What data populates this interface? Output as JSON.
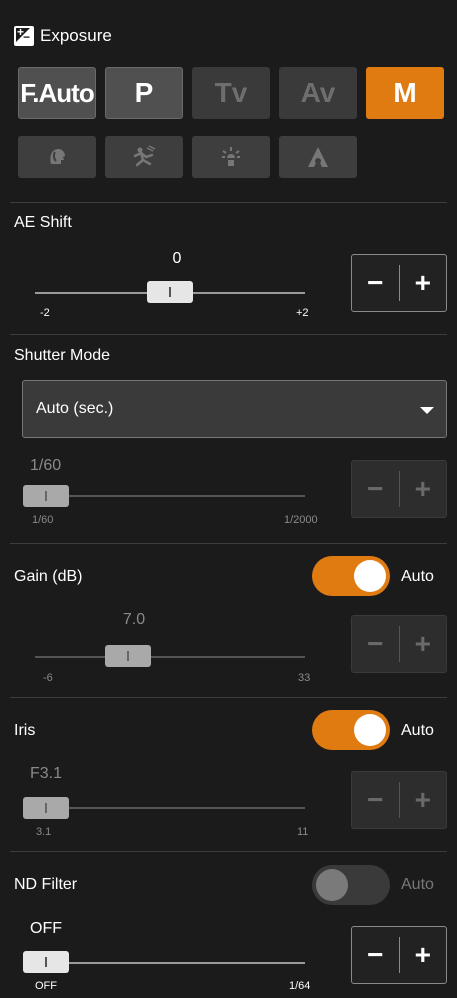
{
  "header": {
    "title": "Exposure",
    "icon": "exposure-icon"
  },
  "modes": [
    {
      "label": "F.Auto",
      "state": "enabled"
    },
    {
      "label": "P",
      "state": "enabled"
    },
    {
      "label": "Tv",
      "state": "disabled"
    },
    {
      "label": "Av",
      "state": "disabled"
    },
    {
      "label": "M",
      "state": "selected"
    }
  ],
  "scene_modes": [
    {
      "icon": "portrait-icon"
    },
    {
      "icon": "sports-icon"
    },
    {
      "icon": "spotlight-icon"
    },
    {
      "icon": "low-light-icon"
    }
  ],
  "ae_shift": {
    "label": "AE Shift",
    "value": "0",
    "min_label": "-2",
    "max_label": "+2",
    "level": 0.5,
    "minus": "−",
    "plus": "+"
  },
  "shutter_mode": {
    "label": "Shutter Mode",
    "selected": "Auto (sec.)",
    "value": "1/60",
    "min_label": "1/60",
    "max_label": "1/2000",
    "level": 0.0,
    "minus": "−",
    "plus": "+"
  },
  "gain": {
    "label": "Gain (dB)",
    "toggle_label": "Auto",
    "toggle_on": true,
    "value": "7.0",
    "min_label": "-6",
    "max_label": "33",
    "level": 0.33,
    "minus": "−",
    "plus": "+"
  },
  "iris": {
    "label": "Iris",
    "toggle_label": "Auto",
    "toggle_on": true,
    "value": "F3.1",
    "min_label": "3.1",
    "max_label": "11",
    "level": 0.0,
    "minus": "−",
    "plus": "+"
  },
  "nd_filter": {
    "label": "ND Filter",
    "toggle_label": "Auto",
    "toggle_on": false,
    "value": "OFF",
    "min_label": "OFF",
    "max_label": "1/64",
    "level": 0.0,
    "minus": "−",
    "plus": "+"
  },
  "colors": {
    "accent": "#e07b12",
    "background": "#1b1b1b",
    "button": "#454545"
  }
}
